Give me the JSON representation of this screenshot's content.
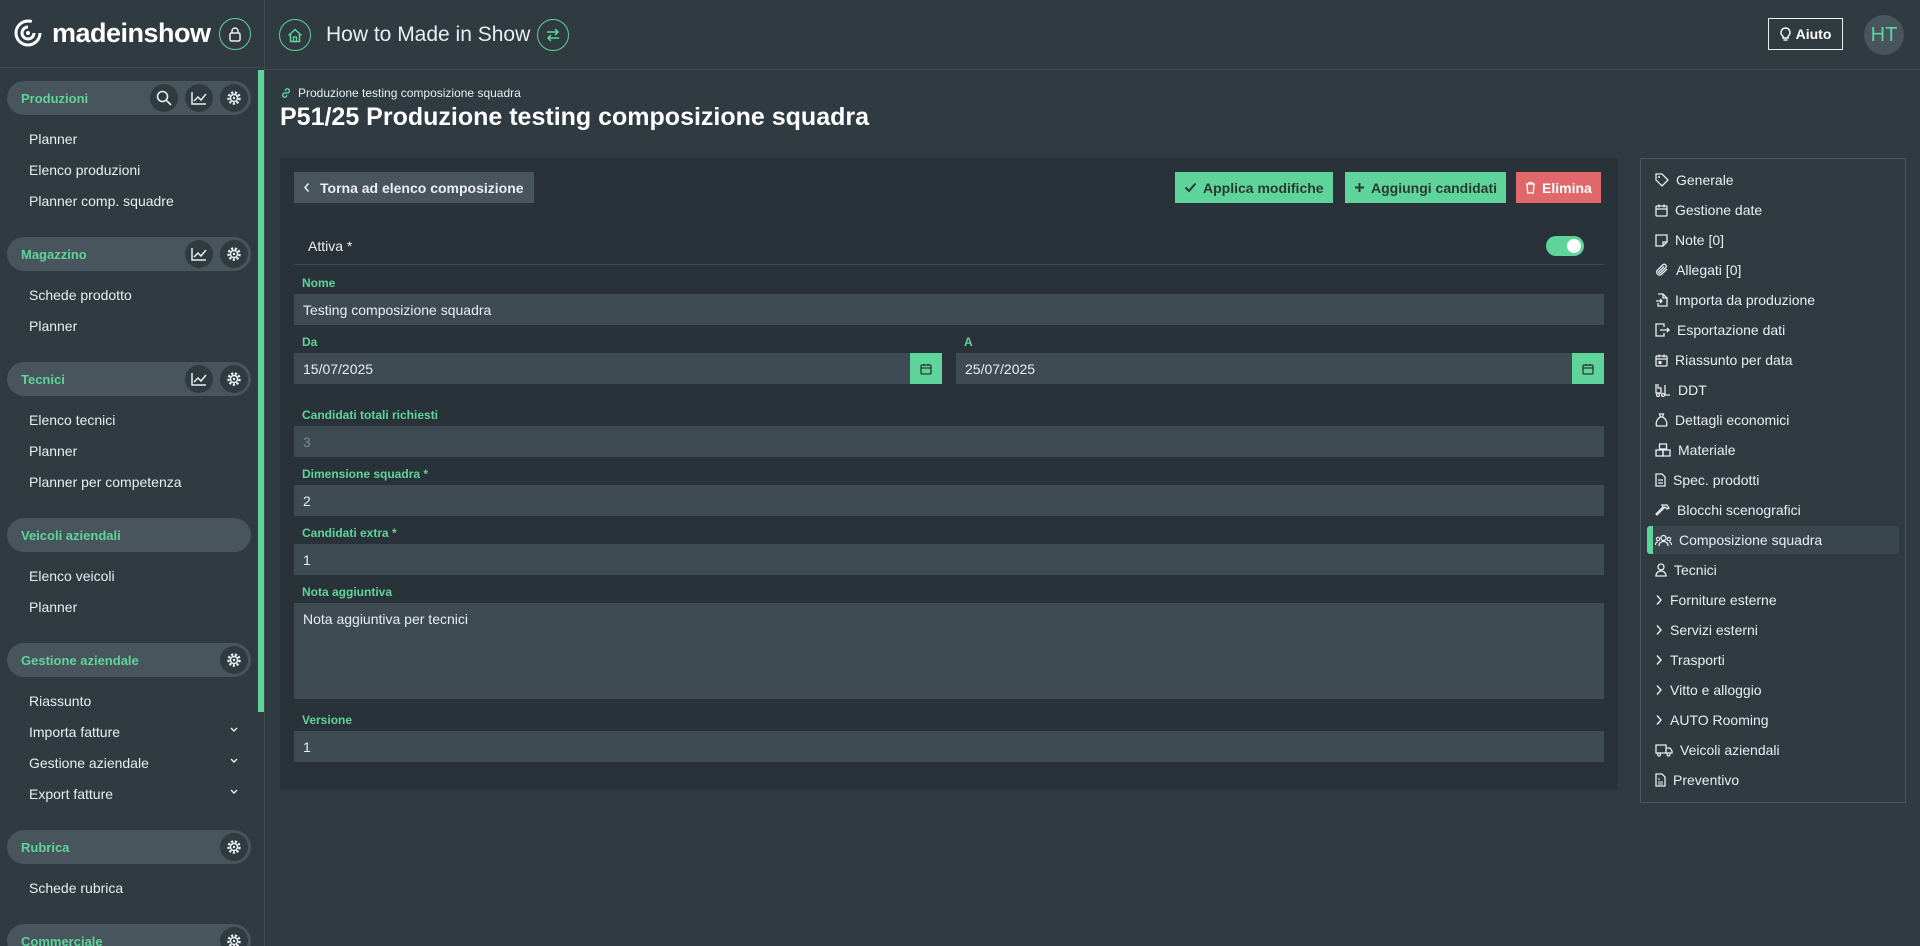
{
  "brand": {
    "name": "madeinshow",
    "accent": "#5fd49a"
  },
  "topbar": {
    "title": "How to Made in Show",
    "help_label": "Aiuto",
    "avatar_initials": "HT"
  },
  "sidebar": {
    "sections": [
      {
        "title": "Produzioni",
        "icons": [
          "search-icon",
          "chart-icon",
          "gear-icon"
        ],
        "items": [
          "Planner",
          "Elenco produzioni",
          "Planner comp. squadre"
        ]
      },
      {
        "title": "Magazzino",
        "icons": [
          "chart-icon",
          "gear-icon"
        ],
        "items": [
          "Schede prodotto",
          "Planner"
        ]
      },
      {
        "title": "Tecnici",
        "icons": [
          "chart-icon",
          "gear-icon"
        ],
        "items": [
          "Elenco tecnici",
          "Planner",
          "Planner per competenza"
        ]
      },
      {
        "title": "Veicoli aziendali",
        "icons": [],
        "items": [
          "Elenco veicoli",
          "Planner"
        ]
      },
      {
        "title": "Gestione aziendale",
        "icons": [
          "gear-icon"
        ],
        "items": [
          "Riassunto",
          "Importa fatture",
          "Gestione aziendale",
          "Export fatture"
        ]
      },
      {
        "title": "Rubrica",
        "icons": [
          "gear-icon"
        ],
        "items": [
          "Schede rubrica"
        ]
      },
      {
        "title": "Commerciale",
        "icons": [
          "gear-icon"
        ],
        "items": []
      }
    ]
  },
  "breadcrumb": "Produzione testing composizione squadra",
  "page_title": "P51/25 Produzione testing composizione squadra",
  "actions": {
    "back": "Torna ad elenco composizione",
    "apply": "Applica modifiche",
    "add": "Aggiungi candidati",
    "delete": "Elimina"
  },
  "form": {
    "attiva_label": "Attiva *",
    "attiva_on": true,
    "nome_label": "Nome",
    "nome_value": "Testing composizione squadra",
    "da_label": "Da",
    "da_value": "15/07/2025",
    "a_label": "A",
    "a_value": "25/07/2025",
    "candidati_totali_label": "Candidati totali richiesti",
    "candidati_totali_value": "3",
    "dimensione_label": "Dimensione squadra *",
    "dimensione_value": "2",
    "extra_label": "Candidati extra *",
    "extra_value": "1",
    "nota_label": "Nota aggiuntiva",
    "nota_value": "Nota aggiuntiva per tecnici",
    "versione_label": "Versione",
    "versione_value": "1"
  },
  "right_menu": [
    {
      "label": "Generale",
      "icon": "tag-icon"
    },
    {
      "label": "Gestione date",
      "icon": "calendar-icon"
    },
    {
      "label": "Note [0]",
      "icon": "note-icon"
    },
    {
      "label": "Allegati [0]",
      "icon": "paperclip-icon"
    },
    {
      "label": "Importa da produzione",
      "icon": "file-import-icon"
    },
    {
      "label": "Esportazione dati",
      "icon": "file-export-icon"
    },
    {
      "label": "Riassunto per data",
      "icon": "calendar-day-icon"
    },
    {
      "label": "DDT",
      "icon": "forklift-icon"
    },
    {
      "label": "Dettagli economici",
      "icon": "money-bag-icon"
    },
    {
      "label": "Materiale",
      "icon": "boxes-icon"
    },
    {
      "label": "Spec. prodotti",
      "icon": "file-icon"
    },
    {
      "label": "Blocchi scenografici",
      "icon": "hammer-icon"
    },
    {
      "label": "Composizione squadra",
      "icon": "team-icon",
      "active": true
    },
    {
      "label": "Tecnici",
      "icon": "user-icon"
    },
    {
      "label": "Forniture esterne",
      "icon": "chevron-right-icon"
    },
    {
      "label": "Servizi esterni",
      "icon": "chevron-right-icon"
    },
    {
      "label": "Trasporti",
      "icon": "chevron-right-icon"
    },
    {
      "label": "Vitto e alloggio",
      "icon": "chevron-right-icon"
    },
    {
      "label": "AUTO Rooming",
      "icon": "chevron-right-icon"
    },
    {
      "label": "Veicoli aziendali",
      "icon": "truck-icon"
    },
    {
      "label": "Preventivo",
      "icon": "invoice-icon"
    }
  ]
}
